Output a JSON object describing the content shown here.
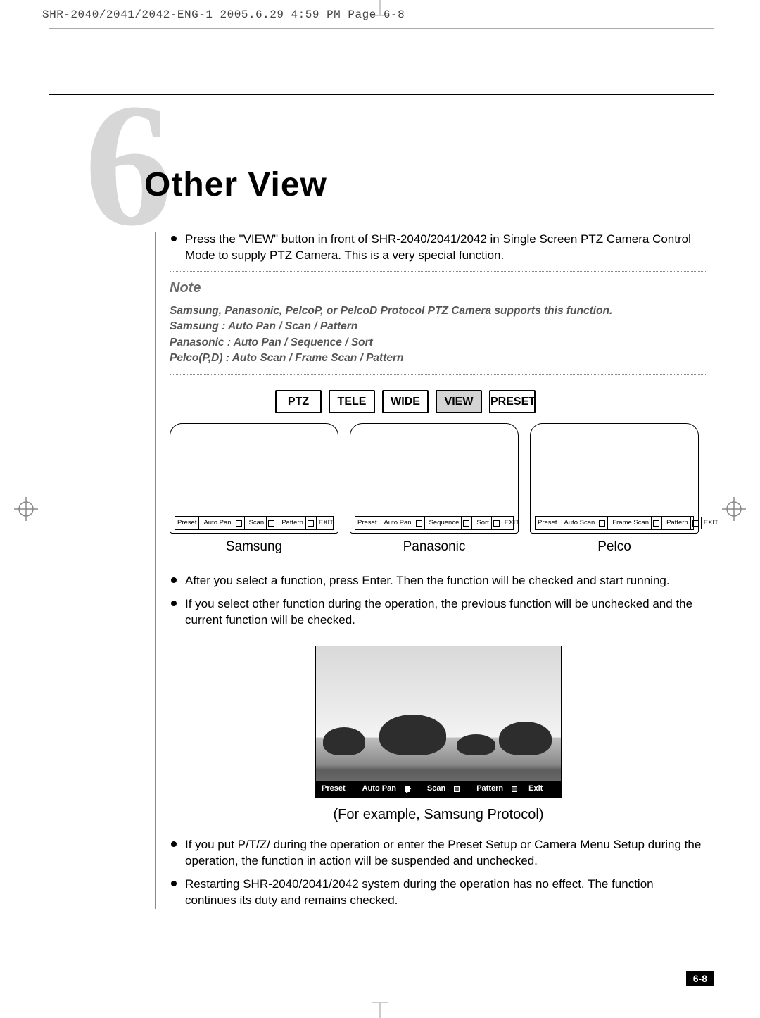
{
  "header_slug": "SHR-2040/2041/2042-ENG-1  2005.6.29  4:59 PM  Page 6-8",
  "chapter_number": "6",
  "chapter_title": "Other View",
  "intro_bullet": "Press the \"VIEW\" button in front of SHR-2040/2041/2042 in Single Screen PTZ Camera Control Mode to supply PTZ Camera. This is a very special function.",
  "note": {
    "heading": "Note",
    "line1": "Samsung, Panasonic, PelcoP, or PelcoD Protocol PTZ Camera supports this function.",
    "line2": "Samsung : Auto Pan / Scan / Pattern",
    "line3": "Panasonic : Auto Pan / Sequence / Sort",
    "line4": "Pelco(P,D) : Auto Scan / Frame Scan / Pattern"
  },
  "buttons": {
    "ptz": "PTZ",
    "tele": "TELE",
    "wide": "WIDE",
    "view": "VIEW",
    "preset": "PRESET"
  },
  "previews": {
    "samsung": {
      "label": "Samsung",
      "bar": {
        "c1": "Preset",
        "c2": "Auto Pan",
        "c3": "Scan",
        "c4": "Pattern",
        "c5": "EXIT"
      }
    },
    "panasonic": {
      "label": "Panasonic",
      "bar": {
        "c1": "Preset",
        "c2": "Auto Pan",
        "c3": "Sequence",
        "c4": "Sort",
        "c5": "EXIT"
      }
    },
    "pelco": {
      "label": "Pelco",
      "bar": {
        "c1": "Preset",
        "c2": "Auto Scan",
        "c3": "Frame Scan",
        "c4": "Pattern",
        "c5": "EXIT"
      }
    }
  },
  "after_bullets": {
    "b1": "After you select a function, press Enter. Then the function will be checked and start running.",
    "b2": "If you select other function during the operation, the previous function will be unchecked and the current function will be checked."
  },
  "screenshot_bar": {
    "c1": "Preset",
    "c2": "Auto Pan",
    "c3": "Scan",
    "c4": "Pattern",
    "c5": "Exit"
  },
  "screenshot_caption": "(For example, Samsung Protocol)",
  "tail_bullets": {
    "b1": "If you put P/T/Z/ during the operation or enter the Preset Setup or Camera Menu Setup during the operation, the function in action will be suspended and unchecked.",
    "b2": "Restarting SHR-2040/2041/2042 system during the operation has no effect. The function continues its duty and remains checked."
  },
  "page_number": "6-8"
}
